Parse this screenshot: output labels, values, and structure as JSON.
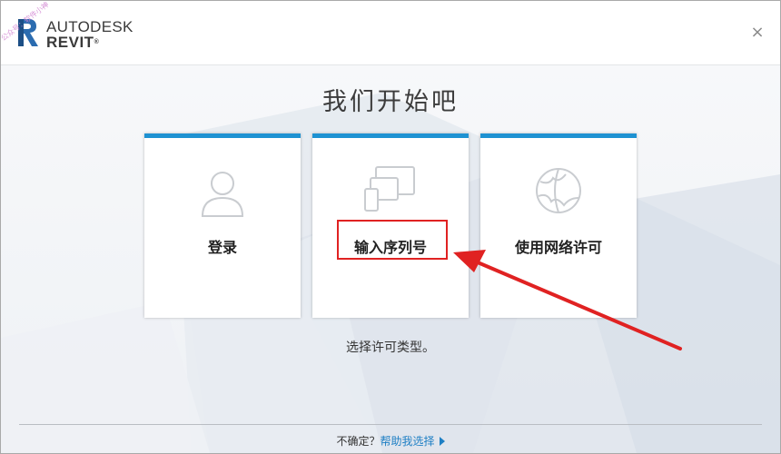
{
  "app": {
    "brand_line1": "AUTODESK",
    "brand_line2": "REVIT",
    "trademark": "®",
    "watermark": "公众号：软件小神"
  },
  "window": {
    "close_label": "×"
  },
  "main": {
    "heading": "我们开始吧",
    "cards": [
      {
        "label": "登录",
        "icon": "user-icon"
      },
      {
        "label": "输入序列号",
        "icon": "devices-icon"
      },
      {
        "label": "使用网络许可",
        "icon": "network-globe-icon"
      }
    ],
    "subtext": "选择许可类型。"
  },
  "footer": {
    "prefix": "不确定？",
    "link": "帮助我选择"
  },
  "colors": {
    "accent": "#1e92d2",
    "annotation": "#e02222",
    "link": "#1e7fc4"
  }
}
